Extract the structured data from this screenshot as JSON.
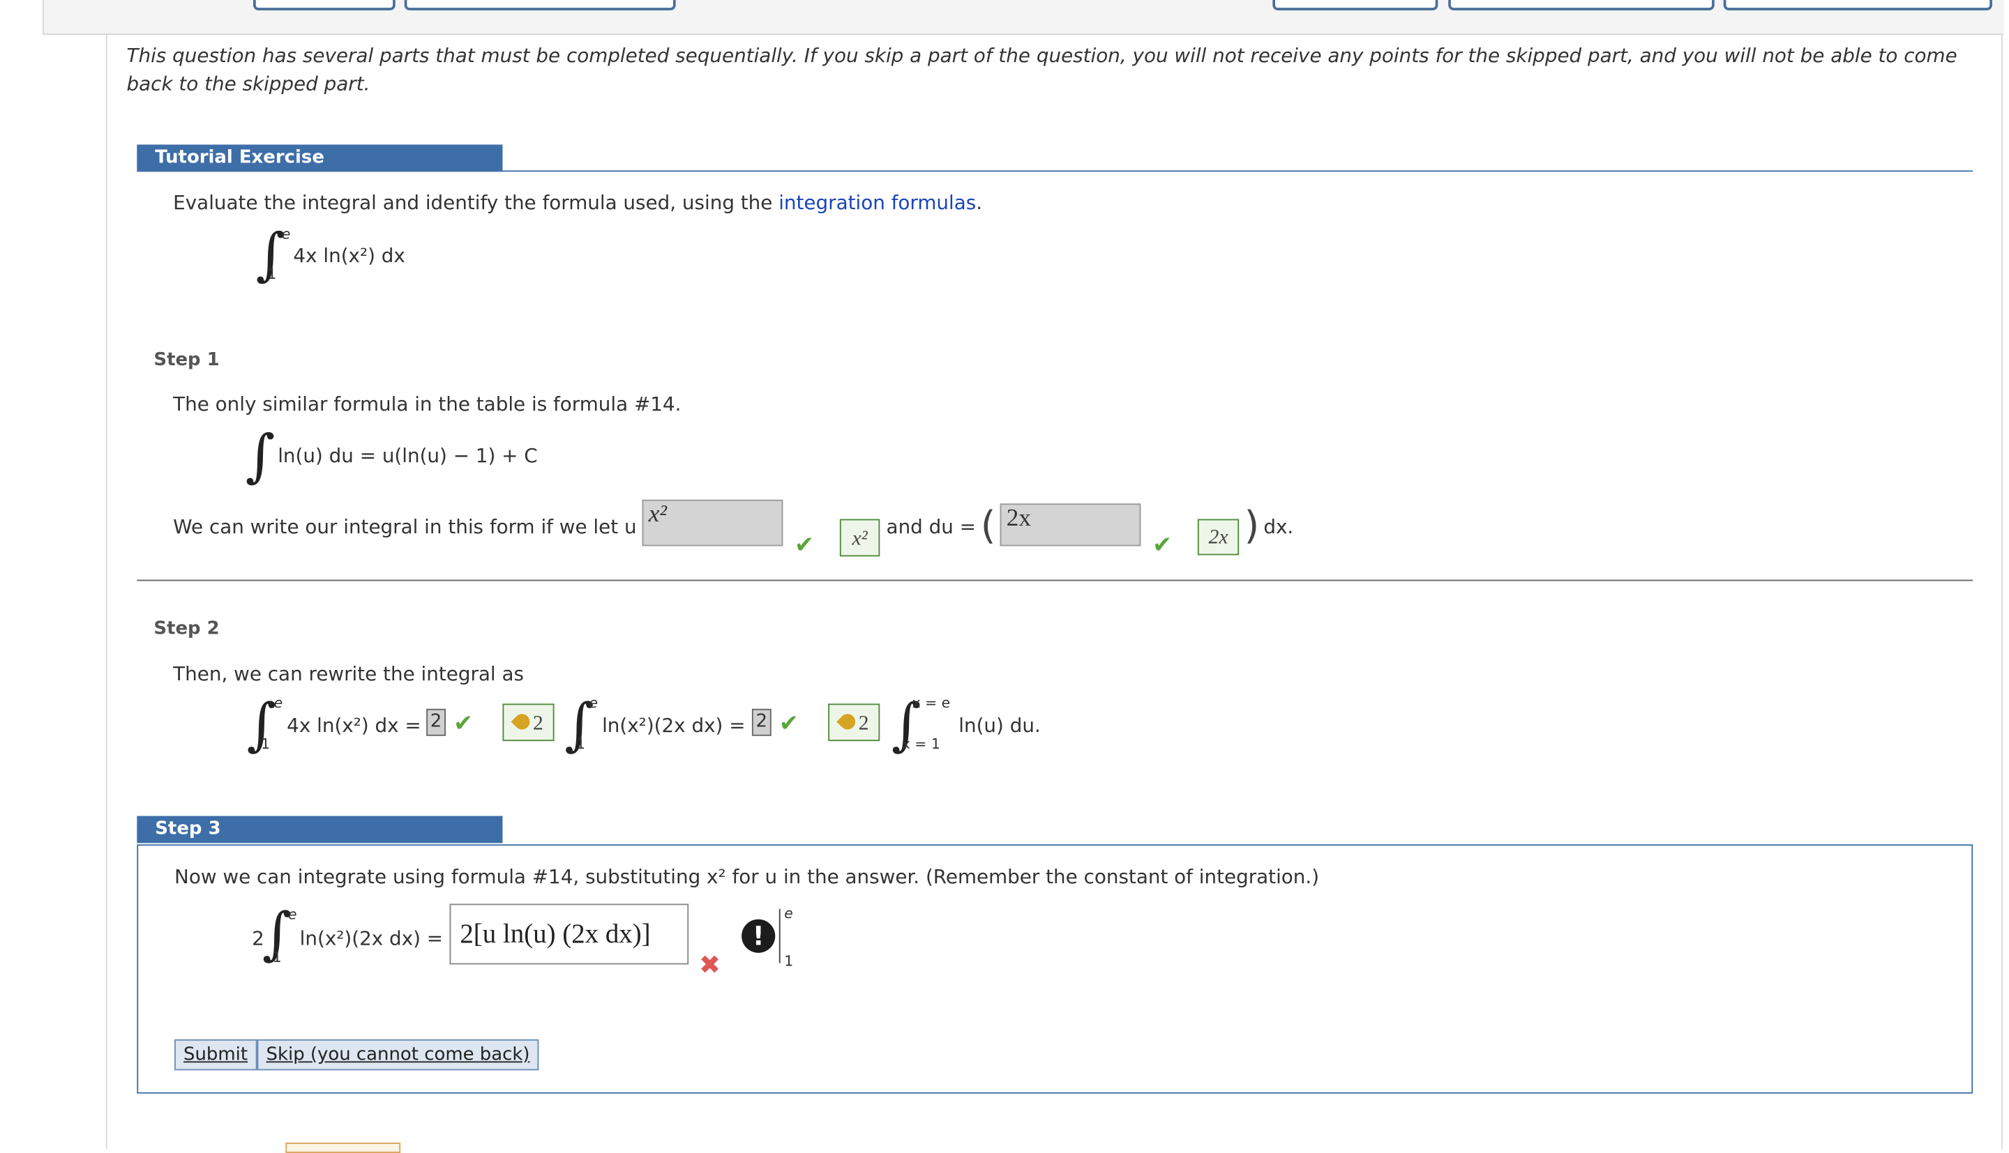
{
  "intro": "This question has several parts that must be completed sequentially. If you skip a part of the question, you will not receive any points for the skipped part, and you will not be able to come back to the skipped part.",
  "tutorial": {
    "header": "Tutorial Exercise",
    "prompt_pre": "Evaluate the integral and identify the formula used, using the ",
    "prompt_link": "integration formulas",
    "prompt_post": ".",
    "integrand": "4x ln(x²) dx",
    "upper": "e",
    "lower": "1"
  },
  "step1": {
    "name": "Step 1",
    "text": "The only similar formula in the table is formula #14.",
    "formula": "ln(u) du = u(ln(u) − 1) + C",
    "sentence_pre": "We can write our integral in this form if we let u = ",
    "u_answer": "x²",
    "u_key": "x²",
    "and_du": "and  du =",
    "du_answer": "2x",
    "du_key": "2x",
    "dx": "dx."
  },
  "step2": {
    "name": "Step 2",
    "text": "Then, we can rewrite the integral as",
    "lhs": "4x ln(x²) dx =",
    "box1": "2",
    "key1": "2",
    "mid": "ln(x²)(2x dx) =",
    "box2": "2",
    "key2": "2",
    "rhs": "ln(u) du.",
    "upper_a": "e",
    "lower_a": "1",
    "upper_b": "e",
    "lower_b": "1",
    "upper_c": "x = e",
    "lower_c": "x = 1"
  },
  "step3": {
    "name": "Step 3",
    "text": "Now we can integrate using formula #14, substituting  x²  for u in the answer. (Remember the constant of integration.)",
    "coef": "2",
    "integrand": "ln(x²)(2x dx) =",
    "upper": "e",
    "lower": "1",
    "answer_value": "2[u ln(u) (2x dx)]",
    "eval_upper": "e",
    "eval_lower": "1",
    "submit_label": "Submit",
    "skip_label": "Skip (you cannot come back)"
  },
  "colors": {
    "header_blue": "#3e6ea8",
    "link_blue": "#1a44b8",
    "correct_green": "#5aa53a",
    "incorrect_red": "#e05555"
  }
}
